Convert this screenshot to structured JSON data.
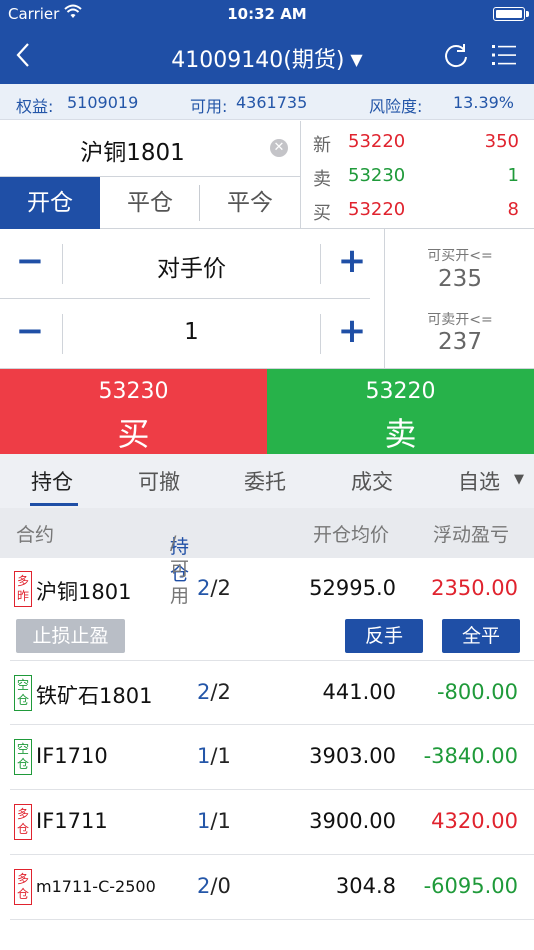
{
  "status_bar": {
    "carrier": "Carrier",
    "time": "10:32 AM"
  },
  "nav": {
    "title": "41009140",
    "title_suffix": "(期货)"
  },
  "account": {
    "equity_label": "权益:",
    "equity_value": "5109019",
    "available_label": "可用:",
    "available_value": "4361735",
    "risk_label": "风险度:",
    "risk_value": "13.39%"
  },
  "order": {
    "contract": "沪铜1801",
    "tabs": [
      "开仓",
      "平仓",
      "平今"
    ],
    "active_tab": 0
  },
  "quote": [
    {
      "label": "新",
      "price": "53220",
      "qty": "350",
      "price_color": "red",
      "qty_color": "red"
    },
    {
      "label": "卖",
      "price": "53230",
      "qty": "1",
      "price_color": "green",
      "qty_color": "green"
    },
    {
      "label": "买",
      "price": "53220",
      "qty": "8",
      "price_color": "red",
      "qty_color": "red"
    }
  ],
  "price_input": {
    "value": "对手价",
    "minus": "−",
    "plus": "+"
  },
  "qty_input": {
    "value": "1",
    "minus": "−",
    "plus": "+"
  },
  "availability": {
    "buy_label": "可买开<=",
    "buy_value": "235",
    "sell_label": "可卖开<=",
    "sell_value": "237"
  },
  "actions": {
    "buy_price": "53230",
    "buy_label": "买",
    "sell_price": "53220",
    "sell_label": "卖"
  },
  "list_tabs": [
    "持仓",
    "可撤",
    "委托",
    "成交",
    "自选"
  ],
  "table_header": {
    "contract": "合约",
    "position_highlight": "持仓",
    "position_rest": "/可用",
    "avg_price": "开仓均价",
    "pnl": "浮动盈亏"
  },
  "positions": [
    {
      "tag": "多昨",
      "side": "long",
      "contract": "沪铜1801",
      "pos": "2",
      "avail": "2",
      "avg": "52995.0",
      "pnl": "2350.00",
      "pnl_color": "red"
    },
    {
      "tag": "空仓",
      "side": "short",
      "contract": "铁矿石1801",
      "pos": "2",
      "avail": "2",
      "avg": "441.00",
      "pnl": "-800.00",
      "pnl_color": "green"
    },
    {
      "tag": "空仓",
      "side": "short",
      "contract": "IF1710",
      "pos": "1",
      "avail": "1",
      "avg": "3903.00",
      "pnl": "-3840.00",
      "pnl_color": "green"
    },
    {
      "tag": "多仓",
      "side": "long",
      "contract": "IF1711",
      "pos": "1",
      "avail": "1",
      "avg": "3900.00",
      "pnl": "4320.00",
      "pnl_color": "red"
    },
    {
      "tag": "多仓",
      "side": "long",
      "contract": "m1711-C-2500",
      "pos": "2",
      "avail": "0",
      "avg": "304.8",
      "pnl": "-6095.00",
      "pnl_color": "green"
    }
  ],
  "row_actions": {
    "stop": "止损止盈",
    "reverse": "反手",
    "close_all": "全平"
  },
  "colors": {
    "brand": "#1f4fa6",
    "buy": "#ee3d46",
    "sell": "#27b24a",
    "up": "#e0232e",
    "down": "#1f9a3a"
  }
}
